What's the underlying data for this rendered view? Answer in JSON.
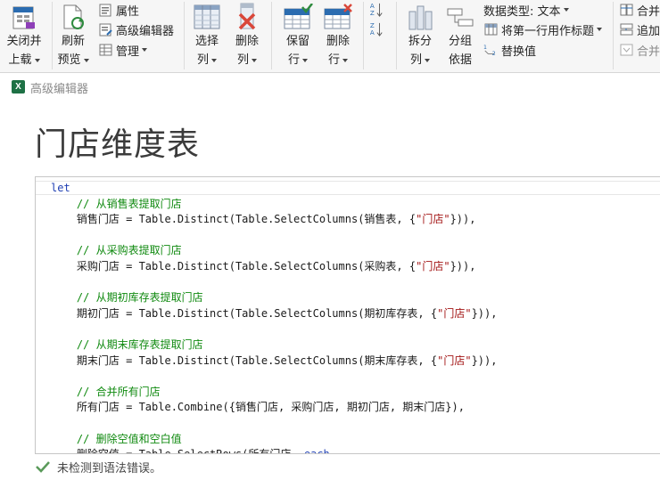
{
  "ribbon": {
    "close_load": {
      "line1": "关闭并",
      "line2": "上载"
    },
    "refresh_preview": {
      "line1": "刷新",
      "line2": "预览"
    },
    "properties": "属性",
    "advanced_editor": "高级编辑器",
    "manage": "管理",
    "choose_columns": {
      "line1": "选择",
      "line2": "列"
    },
    "remove_columns": {
      "line1": "删除",
      "line2": "列"
    },
    "keep_rows": {
      "line1": "保留",
      "line2": "行"
    },
    "remove_rows": {
      "line1": "删除",
      "line2": "行"
    },
    "split_column": {
      "line1": "拆分",
      "line2": "列"
    },
    "group_by": {
      "line1": "分组",
      "line2": "依据"
    },
    "data_type": "数据类型: 文本",
    "use_first_row": "将第一行用作标题",
    "replace_values": "替换值",
    "merge": "合并",
    "append": "追加",
    "combine": "合并"
  },
  "window": {
    "title": "高级编辑器"
  },
  "query": {
    "title": "门店维度表"
  },
  "editor": {
    "lines": [
      [
        {
          "c": "kw",
          "t": "let"
        }
      ],
      [
        {
          "c": "cm",
          "t": "    // 从销售表提取门店"
        }
      ],
      [
        {
          "c": "tx",
          "t": "    销售门店 = Table.Distinct(Table.SelectColumns(销售表, {"
        },
        {
          "c": "st",
          "t": "\"门店\""
        },
        {
          "c": "tx",
          "t": "})),"
        }
      ],
      [
        {
          "c": "tx",
          "t": ""
        }
      ],
      [
        {
          "c": "cm",
          "t": "    // 从采购表提取门店"
        }
      ],
      [
        {
          "c": "tx",
          "t": "    采购门店 = Table.Distinct(Table.SelectColumns(采购表, {"
        },
        {
          "c": "st",
          "t": "\"门店\""
        },
        {
          "c": "tx",
          "t": "})),"
        }
      ],
      [
        {
          "c": "tx",
          "t": ""
        }
      ],
      [
        {
          "c": "cm",
          "t": "    // 从期初库存表提取门店"
        }
      ],
      [
        {
          "c": "tx",
          "t": "    期初门店 = Table.Distinct(Table.SelectColumns(期初库存表, {"
        },
        {
          "c": "st",
          "t": "\"门店\""
        },
        {
          "c": "tx",
          "t": "})),"
        }
      ],
      [
        {
          "c": "tx",
          "t": ""
        }
      ],
      [
        {
          "c": "cm",
          "t": "    // 从期末库存表提取门店"
        }
      ],
      [
        {
          "c": "tx",
          "t": "    期末门店 = Table.Distinct(Table.SelectColumns(期末库存表, {"
        },
        {
          "c": "st",
          "t": "\"门店\""
        },
        {
          "c": "tx",
          "t": "})),"
        }
      ],
      [
        {
          "c": "tx",
          "t": ""
        }
      ],
      [
        {
          "c": "cm",
          "t": "    // 合并所有门店"
        }
      ],
      [
        {
          "c": "tx",
          "t": "    所有门店 = Table.Combine({销售门店, 采购门店, 期初门店, 期末门店}),"
        }
      ],
      [
        {
          "c": "tx",
          "t": ""
        }
      ],
      [
        {
          "c": "cm",
          "t": "    // 删除空值和空白值"
        }
      ],
      [
        {
          "c": "tx",
          "t": "    删除空值 = Table.SelectRows(所有门店, "
        },
        {
          "c": "kw",
          "t": "each"
        }
      ]
    ]
  },
  "status": {
    "message": "未检测到语法错误。"
  },
  "colors": {
    "accent_blue": "#2b6cb0",
    "check_green": "#5a9a5a",
    "remove_red": "#d9473a"
  }
}
